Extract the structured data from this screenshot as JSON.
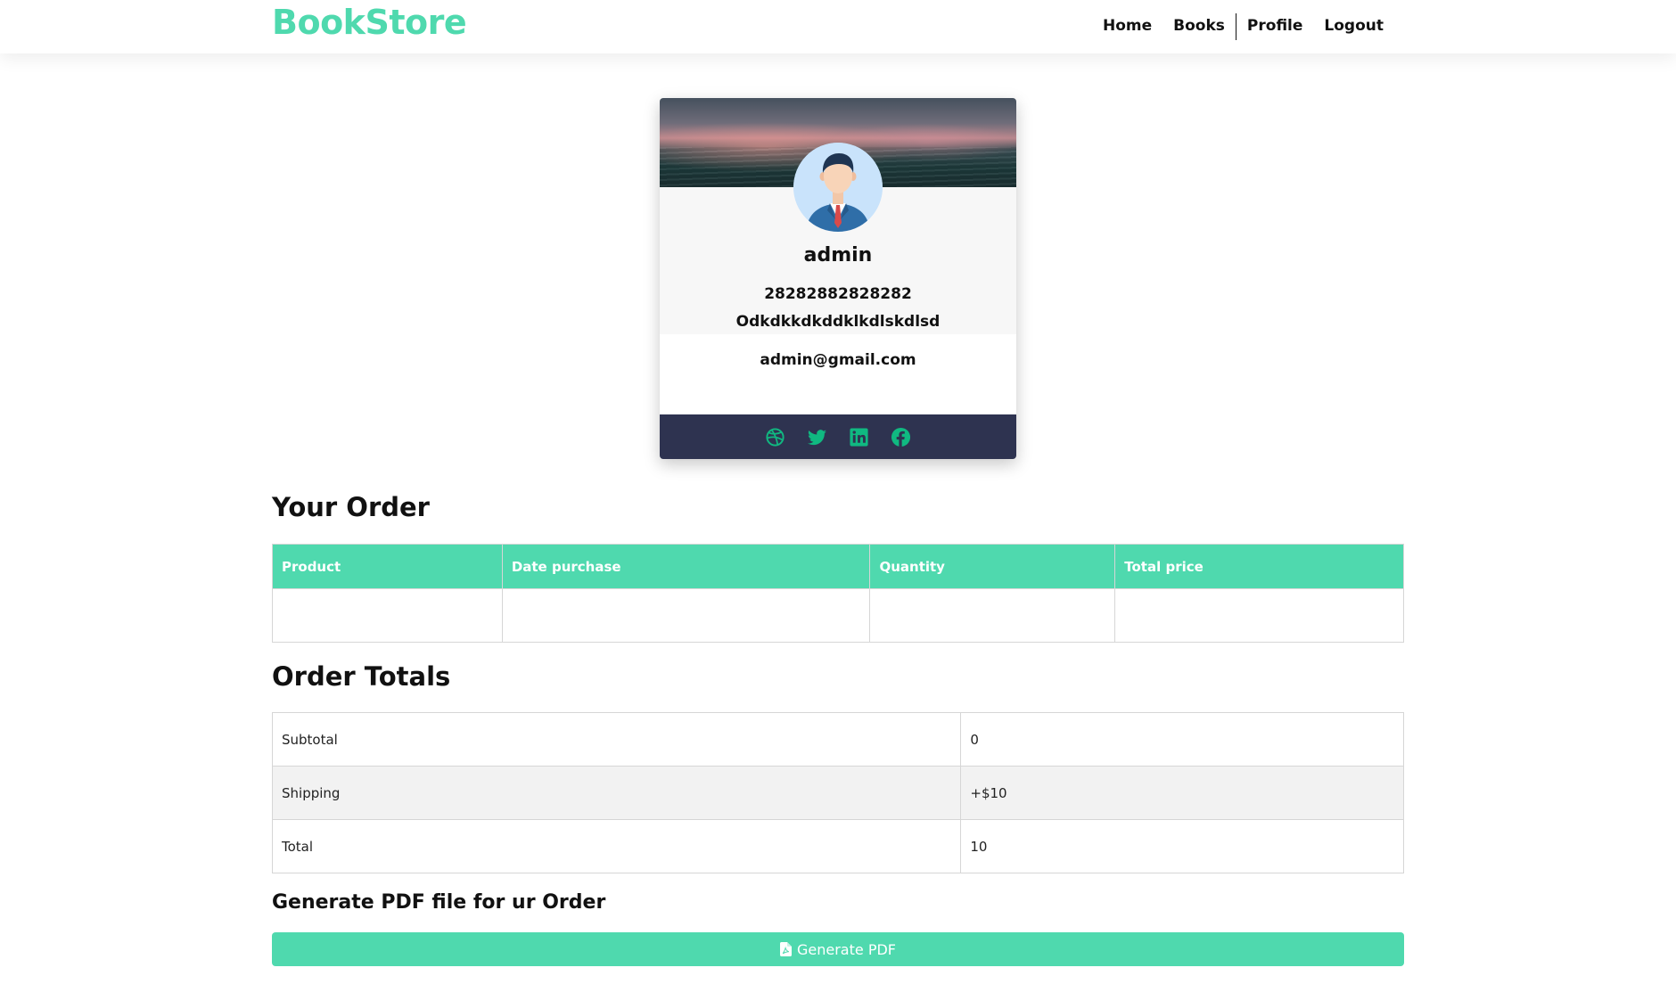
{
  "brand": "BookStore",
  "nav": {
    "home": "Home",
    "books": "Books",
    "profile": "Profile",
    "logout": "Logout"
  },
  "profile": {
    "name": "admin",
    "phone": "28282882828282",
    "address": "Odkdkkdkddklkdlskdlsd",
    "email": "admin@gmail.com",
    "social_icons": [
      "dribbble-icon",
      "twitter-icon",
      "linkedin-icon",
      "facebook-icon"
    ]
  },
  "orders": {
    "title": "Your Order",
    "columns": [
      "Product",
      "Date purchase",
      "Quantity",
      "Total price"
    ],
    "rows": [
      [
        "",
        "",
        "",
        ""
      ]
    ]
  },
  "totals": {
    "title": "Order Totals",
    "rows": [
      {
        "label": "Subtotal",
        "value": "0"
      },
      {
        "label": "Shipping",
        "value": "+$10"
      },
      {
        "label": "Total",
        "value": "10"
      }
    ]
  },
  "pdf": {
    "title": "Generate PDF file for ur Order",
    "button_label": "Generate PDF"
  },
  "colors": {
    "accent": "#4fd9ae",
    "card_footer": "#2e3350"
  }
}
